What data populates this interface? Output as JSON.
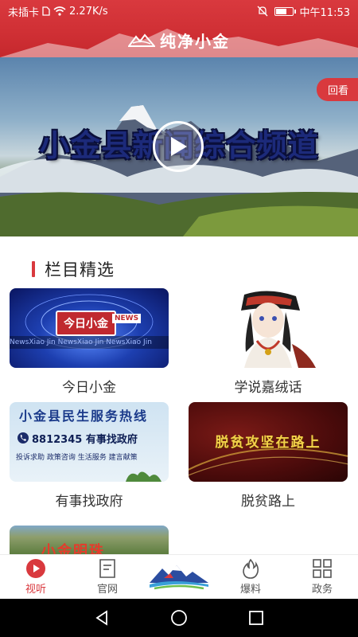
{
  "status_bar": {
    "carrier": "未插卡",
    "speed": "2.27K/s",
    "time": "中午11:53"
  },
  "app": {
    "title": "纯净小金"
  },
  "hero": {
    "title": "小金县新闻综合频道",
    "replay_label": "回看"
  },
  "section": {
    "title": "栏目精选"
  },
  "programs": [
    {
      "label": "今日小金",
      "thumb_text": "今日小金",
      "thumb_badge": "NEWS",
      "thumb_ticker": "NewsXiao Jin NewsXiao Jin NewsXiao Jin"
    },
    {
      "label": "学说嘉绒话"
    },
    {
      "label": "有事找政府",
      "thumb_line1": "小金县民生服务热线",
      "thumb_line2": "8812345 有事找政府",
      "thumb_line3": "投诉求助 政策咨询 生活服务 建言献策"
    },
    {
      "label": "脱贫路上",
      "thumb_text": "脱贫攻坚在路上"
    },
    {
      "thumb_text": "小金明珠"
    }
  ],
  "tabs": [
    {
      "label": "视听",
      "icon": "play-circle-icon"
    },
    {
      "label": "官网",
      "icon": "document-icon"
    },
    {
      "label": "",
      "icon": "mountain-logo-icon"
    },
    {
      "label": "爆料",
      "icon": "flame-icon"
    },
    {
      "label": "政务",
      "icon": "grid-icon"
    }
  ],
  "colors": {
    "brand_red": "#d9393e",
    "tab_active": "#d9393e",
    "tab_inactive": "#555555"
  }
}
